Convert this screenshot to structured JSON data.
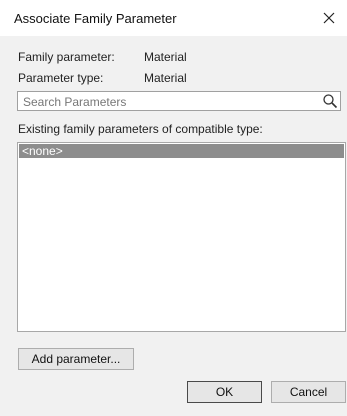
{
  "window": {
    "title": "Associate Family Parameter"
  },
  "info": {
    "family_parameter_label": "Family parameter:",
    "family_parameter_value": "Material",
    "parameter_type_label": "Parameter type:",
    "parameter_type_value": "Material"
  },
  "search": {
    "placeholder": "Search Parameters",
    "value": ""
  },
  "list": {
    "label": "Existing family parameters of compatible type:",
    "items": [
      "<none>"
    ]
  },
  "buttons": {
    "add_parameter": "Add parameter...",
    "ok": "OK",
    "cancel": "Cancel"
  },
  "icons": {
    "close": "close-icon",
    "search": "search-icon"
  }
}
